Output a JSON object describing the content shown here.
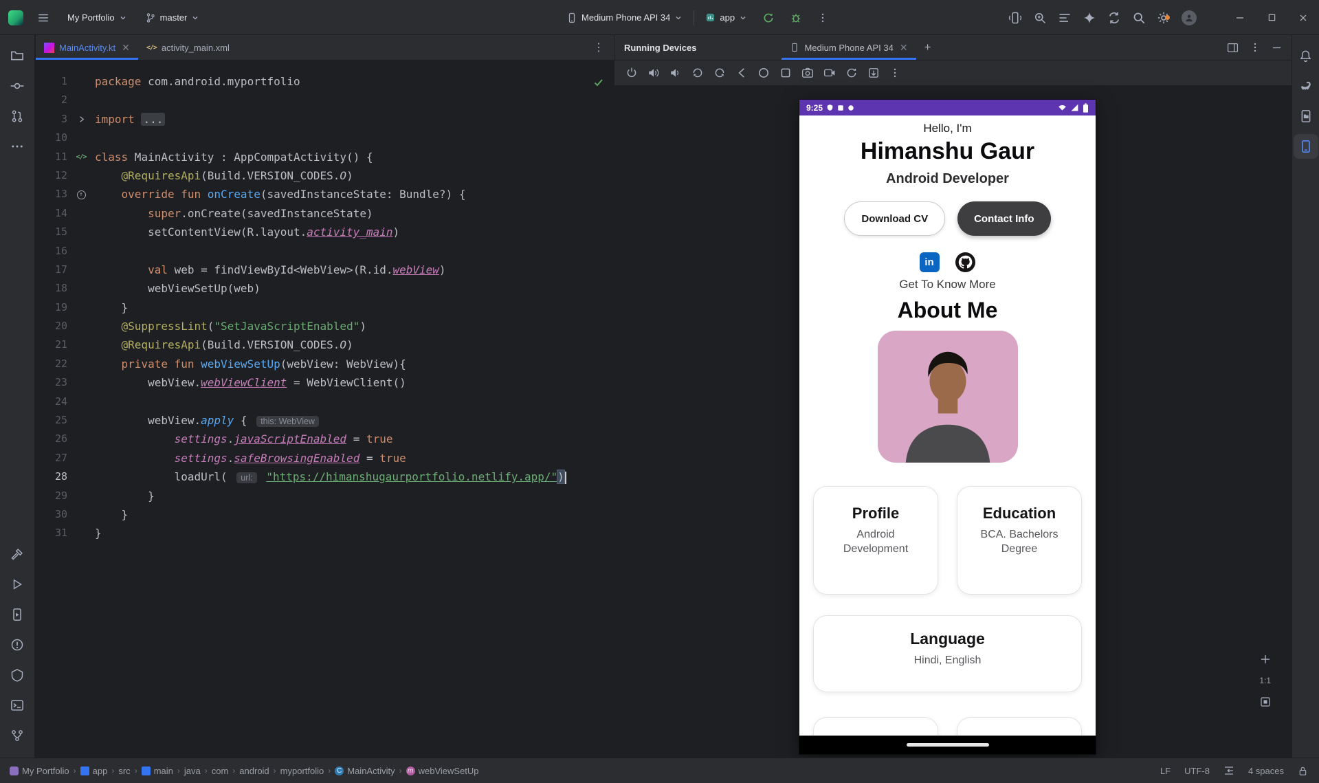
{
  "toolbar": {
    "project": "My Portfolio",
    "branch": "master",
    "device_select": "Medium Phone API 34",
    "run_config": "app"
  },
  "editor": {
    "tabs": [
      {
        "label": "MainActivity.kt"
      },
      {
        "label": "activity_main.xml"
      }
    ],
    "lines": [
      {
        "num": "1",
        "t": [
          [
            "kw",
            "package"
          ],
          [
            "pl",
            " com.android.myportfolio"
          ]
        ]
      },
      {
        "num": "2",
        "t": []
      },
      {
        "num": "3",
        "g": "fold",
        "t": [
          [
            "kw",
            "import"
          ],
          [
            "pl",
            " "
          ],
          [
            "fold",
            "..."
          ]
        ]
      },
      {
        "num": "10",
        "t": []
      },
      {
        "num": "11",
        "g": "xml",
        "t": [
          [
            "kw",
            "class"
          ],
          [
            "pl",
            " MainActivity : AppCompatActivity() {"
          ]
        ]
      },
      {
        "num": "12",
        "t": [
          [
            "pl",
            "    "
          ],
          [
            "ann",
            "@RequiresApi"
          ],
          [
            "pl",
            "(Build.VERSION_CODES."
          ],
          [
            "cnst",
            "O"
          ],
          [
            "pl",
            ")"
          ]
        ]
      },
      {
        "num": "13",
        "g": "ovr",
        "t": [
          [
            "pl",
            "    "
          ],
          [
            "kw",
            "override fun "
          ],
          [
            "fn",
            "onCreate"
          ],
          [
            "pl",
            "(savedInstanceState: Bundle?) {"
          ]
        ]
      },
      {
        "num": "14",
        "t": [
          [
            "pl",
            "        "
          ],
          [
            "kw",
            "super"
          ],
          [
            "pl",
            ".onCreate(savedInstanceState)"
          ]
        ]
      },
      {
        "num": "15",
        "t": [
          [
            "pl",
            "        setContentView(R.layout."
          ],
          [
            "fldU",
            "activity_main"
          ],
          [
            "pl",
            ")"
          ]
        ]
      },
      {
        "num": "16",
        "t": []
      },
      {
        "num": "17",
        "t": [
          [
            "pl",
            "        "
          ],
          [
            "kw",
            "val"
          ],
          [
            "pl",
            " web = findViewById<WebView>(R.id."
          ],
          [
            "fldU",
            "webView"
          ],
          [
            "pl",
            ")"
          ]
        ]
      },
      {
        "num": "18",
        "t": [
          [
            "pl",
            "        webViewSetUp(web)"
          ]
        ]
      },
      {
        "num": "19",
        "t": [
          [
            "pl",
            "    }"
          ]
        ]
      },
      {
        "num": "20",
        "t": [
          [
            "pl",
            "    "
          ],
          [
            "ann",
            "@SuppressLint"
          ],
          [
            "pl",
            "("
          ],
          [
            "str",
            "\"SetJavaScriptEnabled\""
          ],
          [
            "pl",
            ")"
          ]
        ]
      },
      {
        "num": "21",
        "t": [
          [
            "pl",
            "    "
          ],
          [
            "ann",
            "@RequiresApi"
          ],
          [
            "pl",
            "(Build.VERSION_CODES."
          ],
          [
            "cnst",
            "O"
          ],
          [
            "pl",
            ")"
          ]
        ]
      },
      {
        "num": "22",
        "t": [
          [
            "pl",
            "    "
          ],
          [
            "kw",
            "private fun "
          ],
          [
            "fn",
            "webViewSetUp"
          ],
          [
            "pl",
            "(webView: WebView){"
          ]
        ]
      },
      {
        "num": "23",
        "t": [
          [
            "pl",
            "        webView."
          ],
          [
            "fldU",
            "webViewClient"
          ],
          [
            "pl",
            " = WebViewClient()"
          ]
        ]
      },
      {
        "num": "24",
        "t": []
      },
      {
        "num": "25",
        "t": [
          [
            "pl",
            "        webView."
          ],
          [
            "ext",
            "apply"
          ],
          [
            "pl",
            " { "
          ],
          [
            "hint",
            "this: WebView"
          ]
        ]
      },
      {
        "num": "26",
        "t": [
          [
            "pl",
            "            "
          ],
          [
            "fld",
            "settings"
          ],
          [
            "pl",
            "."
          ],
          [
            "fldU",
            "javaScriptEnabled"
          ],
          [
            "pl",
            " = "
          ],
          [
            "kw",
            "true"
          ]
        ]
      },
      {
        "num": "27",
        "t": [
          [
            "pl",
            "            "
          ],
          [
            "fld",
            "settings"
          ],
          [
            "pl",
            "."
          ],
          [
            "fldU",
            "safeBrowsingEnabled"
          ],
          [
            "pl",
            " = "
          ],
          [
            "kw",
            "true"
          ]
        ]
      },
      {
        "num": "28",
        "active": true,
        "caret": true,
        "t": [
          [
            "pl",
            "            loadUrl( "
          ],
          [
            "hint",
            "url:"
          ],
          [
            "pl",
            " "
          ],
          [
            "strU",
            "\"https://himanshugaurportfolio.netlify.app/\""
          ],
          [
            "mtc",
            ")"
          ]
        ]
      },
      {
        "num": "29",
        "t": [
          [
            "pl",
            "        }"
          ]
        ]
      },
      {
        "num": "30",
        "t": [
          [
            "pl",
            "    }"
          ]
        ]
      },
      {
        "num": "31",
        "t": [
          [
            "pl",
            "}"
          ]
        ]
      }
    ]
  },
  "devices_panel": {
    "title": "Running Devices",
    "tab_label": "Medium Phone API 34",
    "zoom_ratio": "1:1"
  },
  "phone": {
    "time": "9:25",
    "greeting": "Hello, I'm",
    "name": "Himanshu Gaur",
    "role": "Android Developer",
    "btn_download": "Download CV",
    "btn_contact": "Contact Info",
    "linkedin_abbr": "in",
    "get_to_know": "Get To Know More",
    "about_title": "About Me",
    "cards": [
      {
        "title": "Profile",
        "body": "Android Development"
      },
      {
        "title": "Education",
        "body": "BCA. Bachelors Degree"
      },
      {
        "title": "Language",
        "body": "Hindi, English"
      }
    ]
  },
  "statusbar": {
    "breadcrumbs": [
      {
        "label": "My Portfolio",
        "icon": "project"
      },
      {
        "label": "app",
        "icon": "module"
      },
      {
        "label": "src",
        "icon": null
      },
      {
        "label": "main",
        "icon": "module"
      },
      {
        "label": "java",
        "icon": null
      },
      {
        "label": "com",
        "icon": null
      },
      {
        "label": "android",
        "icon": null
      },
      {
        "label": "myportfolio",
        "icon": null
      },
      {
        "label": "MainActivity",
        "icon": "class"
      },
      {
        "label": "webViewSetUp",
        "icon": "method"
      }
    ],
    "line_sep": "LF",
    "encoding": "UTF-8",
    "indent": "4 spaces"
  }
}
